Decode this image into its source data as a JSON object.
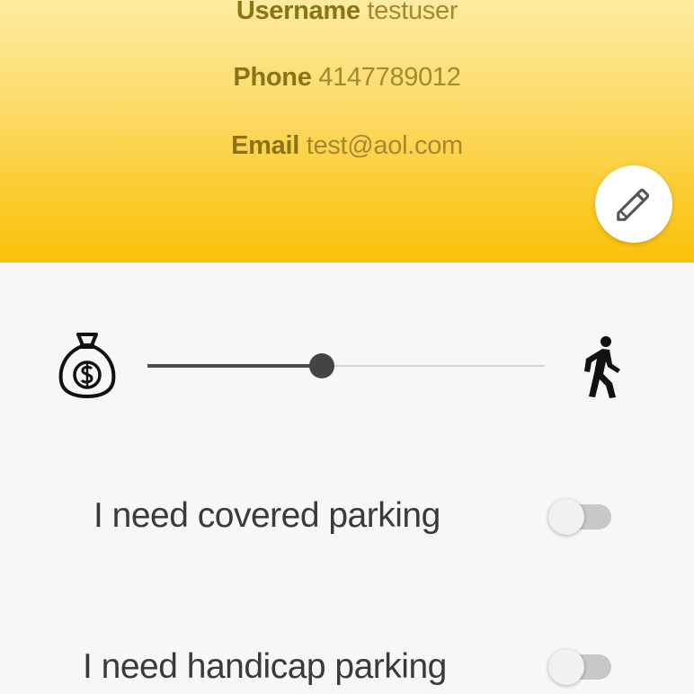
{
  "profile": {
    "username_label": "Username",
    "username_value": "testuser",
    "phone_label": "Phone",
    "phone_value": "4147789012",
    "email_label": "Email",
    "email_value": "test@aol.com",
    "edit_icon": "pencil-icon"
  },
  "preference_slider": {
    "left_icon": "money-bag-icon",
    "right_icon": "walking-person-icon",
    "level_fraction": 0.44
  },
  "options": [
    {
      "label": "I need covered parking",
      "enabled": false
    },
    {
      "label": "I need handicap parking",
      "enabled": false
    }
  ],
  "colors": {
    "header_top": "#fdeba0",
    "header_bottom": "#fbc10a",
    "background": "#f7f7f7",
    "slider_active": "#4d4d4d",
    "toggle_track_off": "#c8c8c8"
  }
}
